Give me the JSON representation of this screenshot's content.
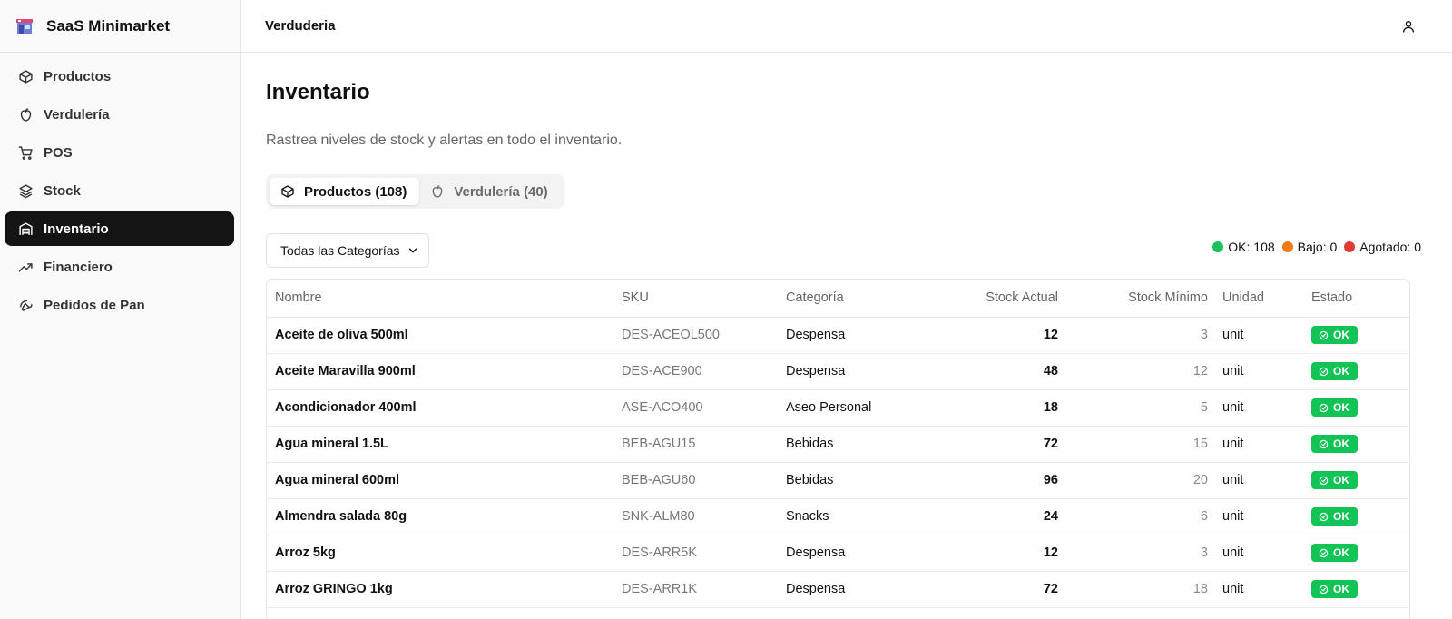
{
  "app": {
    "name": "SaaS Minimarket"
  },
  "sidebar": {
    "items": [
      {
        "label": "Productos",
        "icon": "box-icon",
        "active": false
      },
      {
        "label": "Verdulería",
        "icon": "apple-icon",
        "active": false
      },
      {
        "label": "POS",
        "icon": "cart-icon",
        "active": false
      },
      {
        "label": "Stock",
        "icon": "layers-icon",
        "active": false
      },
      {
        "label": "Inventario",
        "icon": "warehouse-icon",
        "active": true
      },
      {
        "label": "Financiero",
        "icon": "trending-up-icon",
        "active": false
      },
      {
        "label": "Pedidos de Pan",
        "icon": "croissant-icon",
        "active": false
      }
    ]
  },
  "header": {
    "title": "Verduderia",
    "user_icon": "user-icon"
  },
  "page": {
    "title": "Inventario",
    "subtitle": "Rastrea niveles de stock y alertas en todo el inventario."
  },
  "tabs": [
    {
      "label": "Productos (108)",
      "icon": "box-icon",
      "active": true
    },
    {
      "label": "Verdulería (40)",
      "icon": "apple-icon",
      "active": false
    }
  ],
  "filter": {
    "selected": "Todas las Categorías"
  },
  "legend": {
    "ok": {
      "text": "OK: 108",
      "color": "#16c45a"
    },
    "low": {
      "text": "Bajo: 0",
      "color": "#f07a1a"
    },
    "out": {
      "text": "Agotado: 0",
      "color": "#e53935"
    }
  },
  "table": {
    "headers": {
      "name": "Nombre",
      "sku": "SKU",
      "category": "Categoría",
      "stock": "Stock Actual",
      "min": "Stock Mínimo",
      "unit": "Unidad",
      "status": "Estado"
    },
    "rows": [
      {
        "name": "Aceite de oliva 500ml",
        "sku": "DES-ACEOL500",
        "category": "Despensa",
        "stock": "12",
        "min": "3",
        "unit": "unit",
        "status": "OK"
      },
      {
        "name": "Aceite Maravilla 900ml",
        "sku": "DES-ACE900",
        "category": "Despensa",
        "stock": "48",
        "min": "12",
        "unit": "unit",
        "status": "OK"
      },
      {
        "name": "Acondicionador 400ml",
        "sku": "ASE-ACO400",
        "category": "Aseo Personal",
        "stock": "18",
        "min": "5",
        "unit": "unit",
        "status": "OK"
      },
      {
        "name": "Agua mineral 1.5L",
        "sku": "BEB-AGU15",
        "category": "Bebidas",
        "stock": "72",
        "min": "15",
        "unit": "unit",
        "status": "OK"
      },
      {
        "name": "Agua mineral 600ml",
        "sku": "BEB-AGU60",
        "category": "Bebidas",
        "stock": "96",
        "min": "20",
        "unit": "unit",
        "status": "OK"
      },
      {
        "name": "Almendra salada 80g",
        "sku": "SNK-ALM80",
        "category": "Snacks",
        "stock": "24",
        "min": "6",
        "unit": "unit",
        "status": "OK"
      },
      {
        "name": "Arroz 5kg",
        "sku": "DES-ARR5K",
        "category": "Despensa",
        "stock": "12",
        "min": "3",
        "unit": "unit",
        "status": "OK"
      },
      {
        "name": "Arroz GRINGO 1kg",
        "sku": "DES-ARR1K",
        "category": "Despensa",
        "stock": "72",
        "min": "18",
        "unit": "unit",
        "status": "OK"
      }
    ]
  }
}
